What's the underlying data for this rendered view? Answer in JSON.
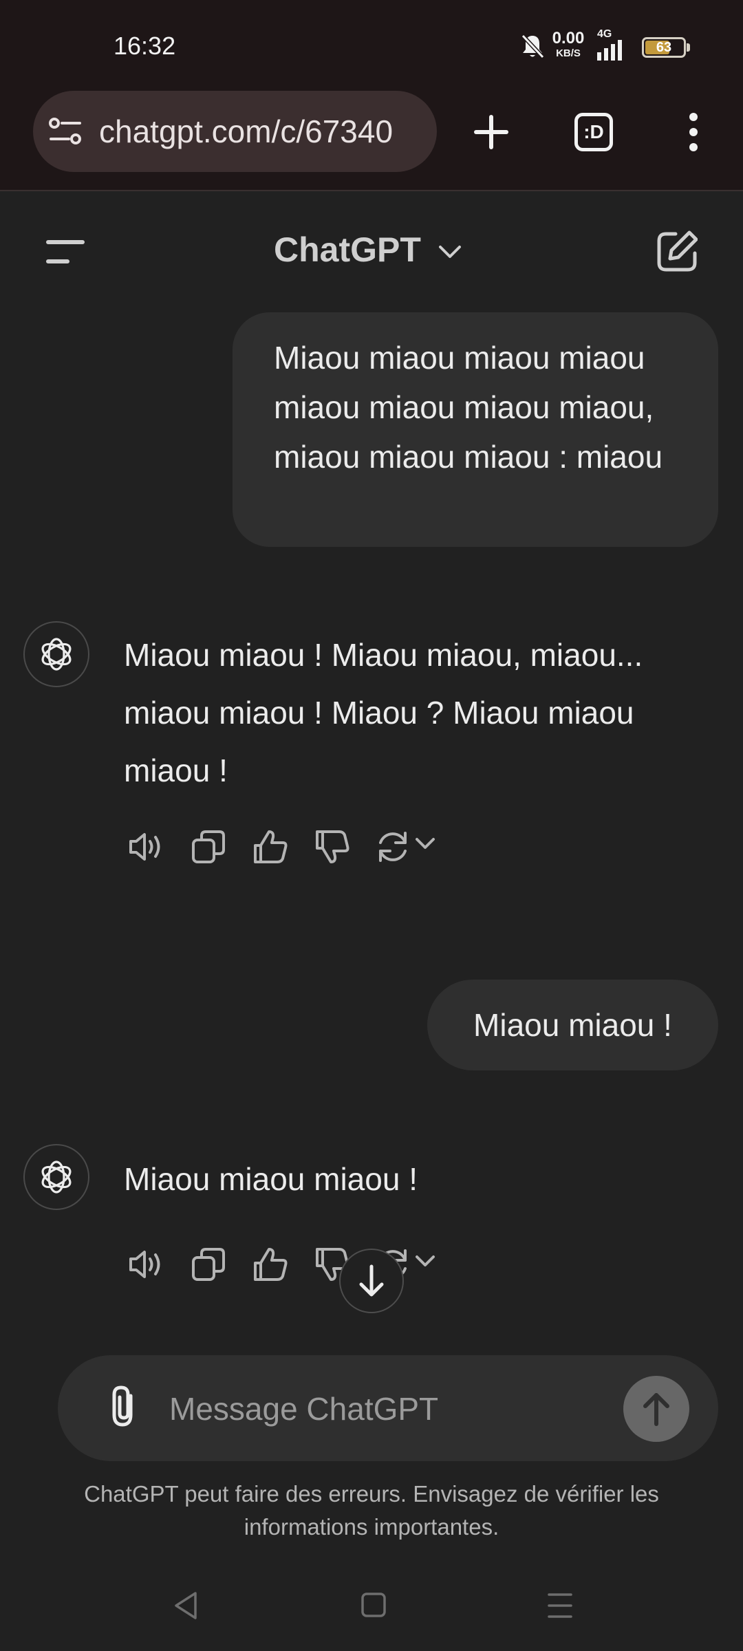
{
  "status_bar": {
    "time": "16:32",
    "net_speed_value": "0.00",
    "net_speed_unit": "KB/S",
    "network_type": "4G",
    "battery_level": "63",
    "icons": [
      "notifications-muted-icon",
      "signal-icon",
      "battery-icon"
    ]
  },
  "browser": {
    "url": "chatgpt.com/c/67340",
    "icons": [
      "site-settings-icon",
      "new-tab-icon",
      "tab-switcher-icon",
      "more-menu-icon"
    ],
    "tab_switcher_label": ":D"
  },
  "header": {
    "title": "ChatGPT",
    "icons": [
      "sidebar-menu-icon",
      "chevron-down-icon",
      "new-chat-icon"
    ]
  },
  "messages": [
    {
      "role": "user",
      "text": "Miaou miaou miaou miaou miaou miaou miaou miaou, miaou miaou miaou : miaou"
    },
    {
      "role": "assistant",
      "text": "Miaou miaou ! Miaou miaou, miaou... miaou miaou ! Miaou ? Miaou miaou miaou !"
    },
    {
      "role": "user",
      "text": "Miaou miaou !"
    },
    {
      "role": "assistant",
      "text": "Miaou miaou miaou !"
    }
  ],
  "message_actions": [
    "read-aloud-icon",
    "copy-icon",
    "thumbs-up-icon",
    "thumbs-down-icon",
    "regenerate-icon",
    "chevron-down-icon"
  ],
  "composer": {
    "placeholder": "Message ChatGPT",
    "icons": [
      "attach-icon",
      "send-icon",
      "scroll-down-icon"
    ]
  },
  "disclaimer": "ChatGPT peut faire des erreurs. Envisagez de vérifier les informations importantes.",
  "nav_bar": {
    "icons": [
      "back-icon",
      "home-icon",
      "recents-icon"
    ]
  },
  "colors": {
    "background": "#212121",
    "bubble": "#2f2f2f",
    "browser_chrome": "#1e1617",
    "url_bar": "#3b2e2f",
    "battery": "#c39a3c",
    "send_button": "#676767"
  }
}
